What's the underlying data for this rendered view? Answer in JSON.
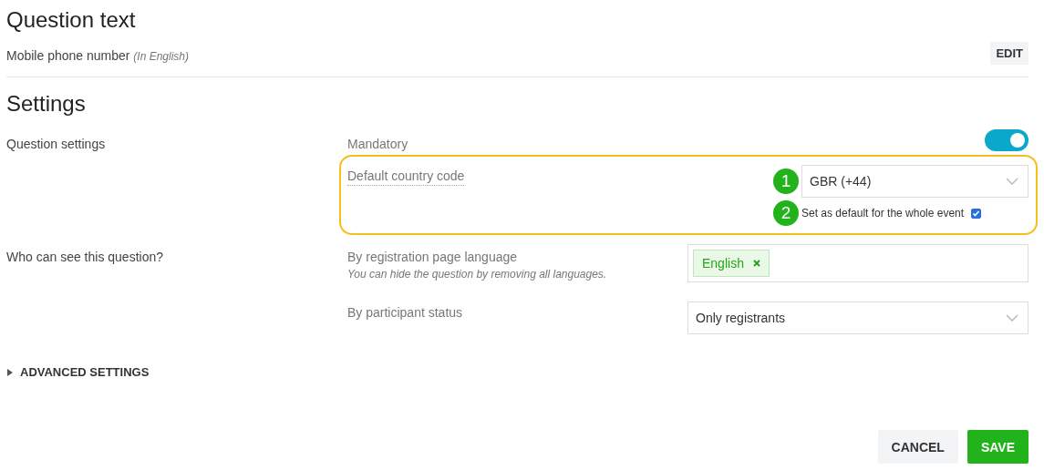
{
  "question": {
    "title": "Question text",
    "text": "Mobile phone number",
    "note": "(In English)",
    "edit_button": "EDIT"
  },
  "settings": {
    "title": "Settings",
    "question_settings": {
      "label": "Question settings",
      "mandatory": {
        "label": "Mandatory",
        "on": true
      },
      "country_code": {
        "label": "Default country code",
        "highlighted": true,
        "select": {
          "badge": "1",
          "value": "GBR (+44)"
        },
        "default_checkbox": {
          "badge": "2",
          "label": "Set as default for the whole event",
          "checked": true
        }
      }
    },
    "visibility": {
      "label": "Who can see this question?",
      "language": {
        "label": "By registration page language",
        "hint": "You can hide the question by removing all languages.",
        "tags": [
          "English"
        ]
      },
      "status": {
        "label": "By participant status",
        "value": "Only registrants"
      }
    }
  },
  "advanced": {
    "label": "ADVANCED SETTINGS",
    "expanded": false
  },
  "buttons": [
    {
      "kind": "secondary",
      "label": "CANCEL"
    },
    {
      "kind": "primary",
      "label": "SAVE"
    }
  ]
}
